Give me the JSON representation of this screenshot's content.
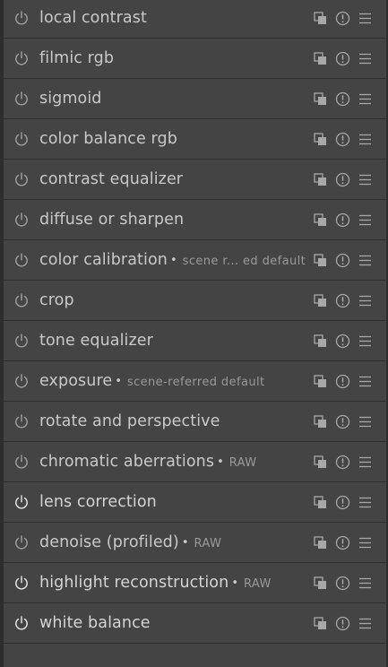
{
  "modules": [
    {
      "name": "local contrast",
      "tag": "",
      "enabled": false
    },
    {
      "name": "filmic rgb",
      "tag": "",
      "enabled": false
    },
    {
      "name": "sigmoid",
      "tag": "",
      "enabled": false
    },
    {
      "name": "color balance rgb",
      "tag": "",
      "enabled": false
    },
    {
      "name": "contrast equalizer",
      "tag": "",
      "enabled": false
    },
    {
      "name": "diffuse or sharpen",
      "tag": "",
      "enabled": false
    },
    {
      "name": "color calibration",
      "tag": "scene r... ed default",
      "enabled": false
    },
    {
      "name": "crop",
      "tag": "",
      "enabled": false
    },
    {
      "name": "tone equalizer",
      "tag": "",
      "enabled": false
    },
    {
      "name": "exposure",
      "tag": "scene-referred default",
      "enabled": false
    },
    {
      "name": "rotate and perspective",
      "tag": "",
      "enabled": false
    },
    {
      "name": "chromatic aberrations",
      "tag": "RAW",
      "enabled": false
    },
    {
      "name": "lens correction",
      "tag": "",
      "enabled": true
    },
    {
      "name": "denoise (profiled)",
      "tag": "RAW",
      "enabled": false
    },
    {
      "name": "highlight reconstruction",
      "tag": "RAW",
      "enabled": true
    },
    {
      "name": "white balance",
      "tag": "",
      "enabled": true
    }
  ],
  "bullet_glyph": "•",
  "icons": {
    "power": "power-icon",
    "instances": "multi-instance-icon",
    "reset": "reset-icon",
    "presets": "presets-menu-icon"
  },
  "colors": {
    "background": "#3d3d3d",
    "row": "#444444",
    "text": "#c9c9c9",
    "tag": "#9a9a9a",
    "icon_off": "#9c9c9c",
    "icon_on": "#e2e2e2"
  }
}
